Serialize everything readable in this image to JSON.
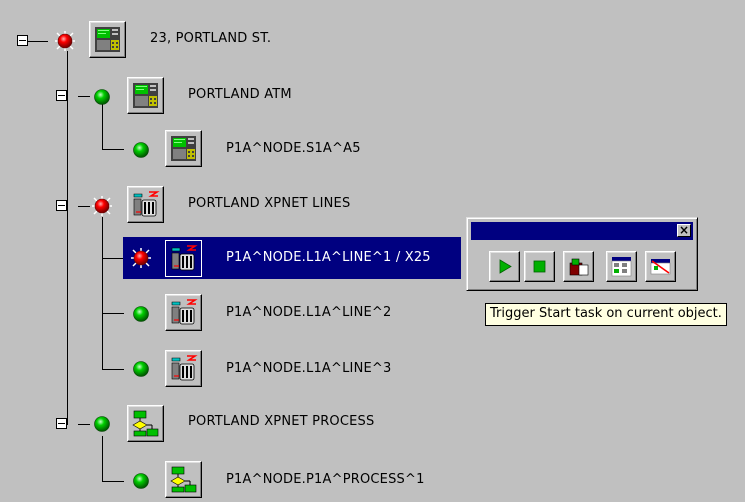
{
  "tree": {
    "nodes": [
      {
        "label": "23, PORTLAND ST.",
        "status": "alarm",
        "icon": "atm-terminal-icon"
      },
      {
        "label": "PORTLAND ATM",
        "status": "ok",
        "icon": "atm-terminal-icon"
      },
      {
        "label": "P1A^NODE.S1A^A5",
        "status": "ok",
        "icon": "atm-terminal-icon"
      },
      {
        "label": "PORTLAND XPNET LINES",
        "status": "alarm",
        "icon": "line-device-icon"
      },
      {
        "label": "P1A^NODE.L1A^LINE^1 / X25",
        "status": "alarm",
        "icon": "line-device-icon",
        "selected": true
      },
      {
        "label": "P1A^NODE.L1A^LINE^2",
        "status": "ok",
        "icon": "line-device-icon"
      },
      {
        "label": "P1A^NODE.L1A^LINE^3",
        "status": "ok",
        "icon": "line-device-icon"
      },
      {
        "label": "PORTLAND XPNET PROCESS",
        "status": "ok",
        "icon": "process-flow-icon"
      },
      {
        "label": "P1A^NODE.P1A^PROCESS^1",
        "status": "ok",
        "icon": "process-flow-icon"
      }
    ]
  },
  "toolbox": {
    "close_glyph": "×",
    "buttons": [
      {
        "name": "start-task",
        "icon": "play-icon"
      },
      {
        "name": "stop-task",
        "icon": "stop-icon"
      },
      {
        "name": "open-task",
        "icon": "open-folder-icon"
      },
      {
        "name": "details",
        "icon": "details-icon"
      },
      {
        "name": "disable",
        "icon": "disable-icon"
      }
    ]
  },
  "tooltip": {
    "text": "Trigger Start task on current object."
  },
  "colors": {
    "alarm": "#ff0000",
    "ok": "#00c000",
    "selection": "#000080",
    "background": "#c0c0c0"
  }
}
